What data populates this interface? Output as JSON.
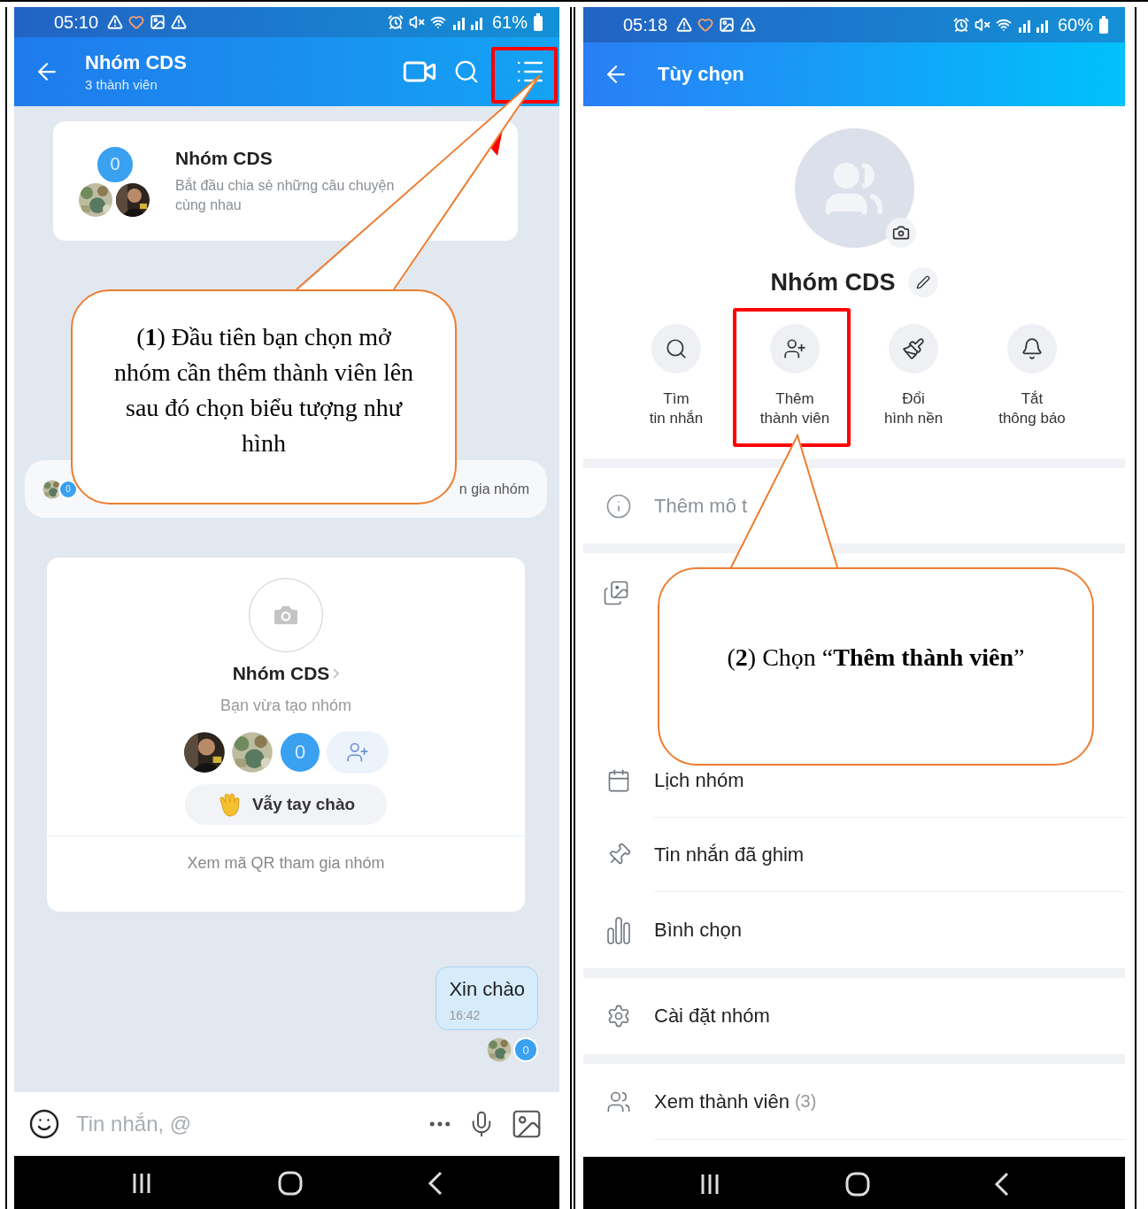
{
  "left_screen": {
    "status_bar": {
      "time": "05:10",
      "battery": "61%"
    },
    "header": {
      "title": "Nhóm CDS",
      "subtitle": "3 thành viên"
    },
    "intro_card": {
      "badge": "0",
      "title": "Nhóm CDS",
      "description": [
        "Bắt đầu chia sẻ những câu chuyện",
        "cùng nhau"
      ]
    },
    "join_notice": {
      "badge": "0",
      "text": "n gia nhóm"
    },
    "group_card": {
      "title": "Nhóm CDS",
      "subtitle": "Bạn vừa tạo nhóm",
      "badge": "0",
      "wave_button": "Vẫy tay chào",
      "qr_link": "Xem mã QR tham gia nhóm"
    },
    "message": {
      "text": "Xin chào",
      "time": "16:42",
      "seen_badge": "0"
    },
    "composer": {
      "placeholder": "Tin nhắn, @"
    }
  },
  "right_screen": {
    "status_bar": {
      "time": "05:18",
      "battery": "60%"
    },
    "header": {
      "title": "Tùy chọn"
    },
    "group_name": "Nhóm CDS",
    "actions": [
      {
        "kind": "search",
        "label": [
          "Tìm",
          "tin nhắn"
        ]
      },
      {
        "kind": "add-member",
        "label": [
          "Thêm",
          "thành viên"
        ]
      },
      {
        "kind": "wallpaper",
        "label": [
          "Đổi",
          "hình nền"
        ]
      },
      {
        "kind": "bell",
        "label": [
          "Tắt",
          "thông báo"
        ]
      }
    ],
    "description_row": {
      "text": "Thêm mô t"
    },
    "menu_sections": [
      {
        "items": [
          {
            "kind": "calendar",
            "label": "Lịch nhóm"
          },
          {
            "kind": "pin",
            "label": "Tin nhắn đã ghim"
          },
          {
            "kind": "poll",
            "label": "Bình chọn"
          }
        ]
      },
      {
        "items": [
          {
            "kind": "settings",
            "label": "Cài đặt nhóm"
          }
        ]
      },
      {
        "items": [
          {
            "kind": "members",
            "label": "Xem thành viên",
            "count": "(3)"
          }
        ]
      }
    ]
  },
  "callouts": [
    {
      "text": "(**1**) Đầu tiên bạn chọn mở nhóm cần thêm thành viên lên sau đó chọn biểu tượng như hình"
    },
    {
      "text": "(**2**) Chọn “**Thêm thành viên**”"
    }
  ]
}
